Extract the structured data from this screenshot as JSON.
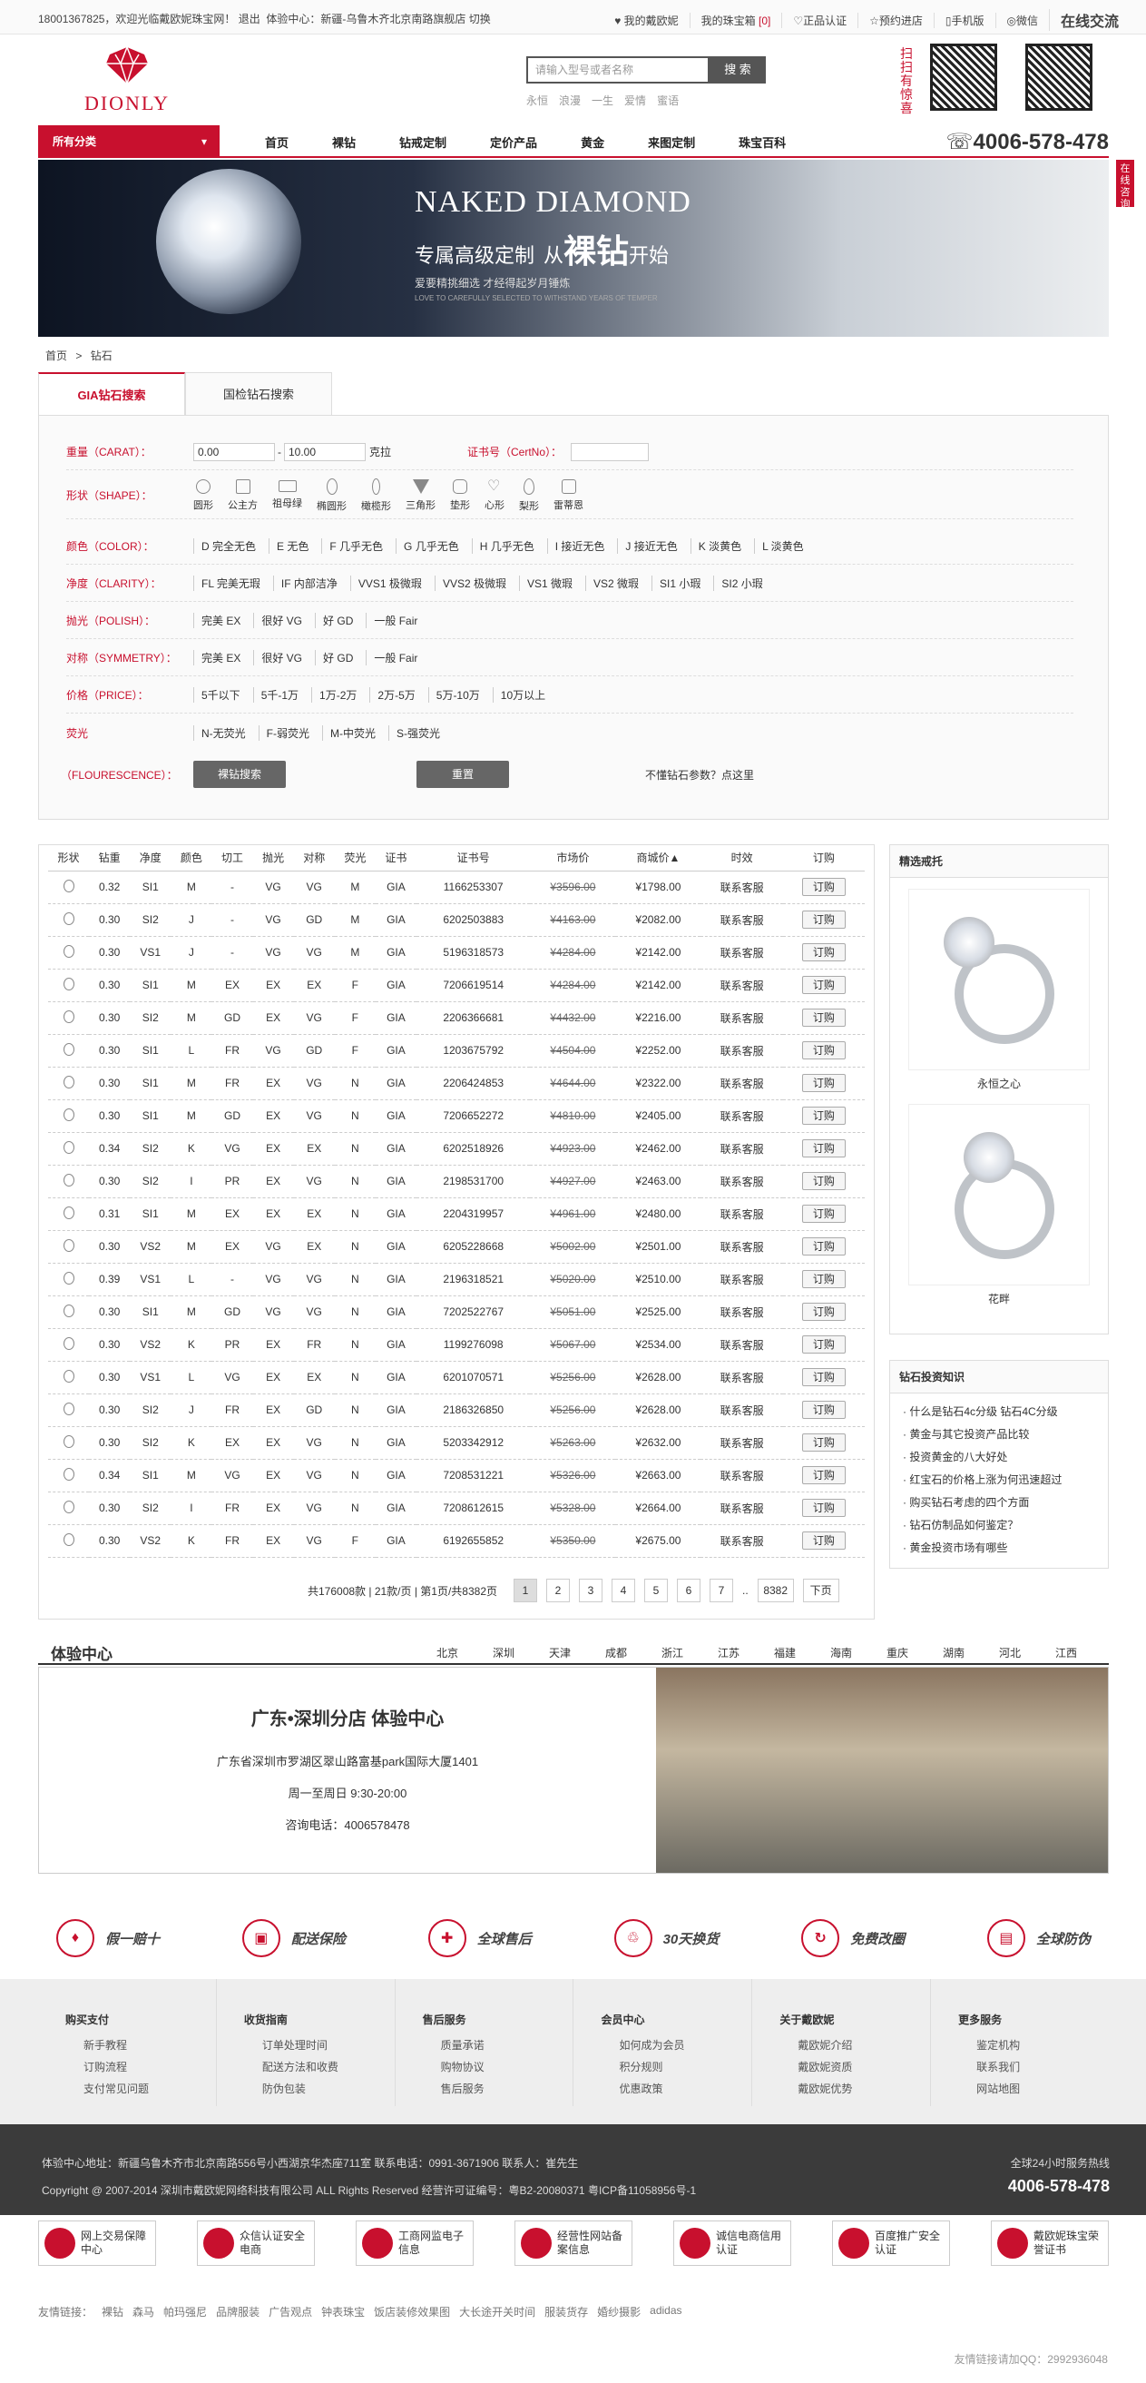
{
  "topbar": {
    "welcome": "18001367825，欢迎光临戴欧妮珠宝网！ 退出",
    "exp": "体验中心：新疆-乌鲁木齐北京南路旗舰店 切换",
    "my_dionly": "♥ 我的戴欧妮",
    "my_bank": "我的珠宝箱",
    "bank_count": "[0]",
    "authentic": "♡正品认证",
    "reserve": "☆预约进店",
    "mobile": "▯手机版",
    "wechat": "◎微信",
    "online": "在线交流"
  },
  "logo": {
    "text": "DIONLY"
  },
  "search": {
    "placeholder": "请输入型号或者名称",
    "button": "搜 索",
    "hot": [
      "永恒",
      "浪漫",
      "一生",
      "爱情",
      "蜜语"
    ]
  },
  "qr": {
    "label": "扫扫有惊喜"
  },
  "nav": {
    "category": "所有分类",
    "items": [
      "首页",
      "裸钻",
      "钻戒定制",
      "定价产品",
      "黄金",
      "来图定制",
      "珠宝百科"
    ],
    "tel": "4006-578-478"
  },
  "banner": {
    "title": "NAKED DIAMOND",
    "sub1": "专属高级定制",
    "sub2": "从",
    "sub3": "裸钻",
    "sub4": "开始",
    "line": "爱要精挑细选 才经得起岁月锤炼",
    "small": "LOVE TO CAREFULLY SELECTED TO WITHSTAND YEARS OF TEMPER"
  },
  "sidead": "在线咨询",
  "crumb": {
    "home": "首页",
    "sep": ">",
    "current": "钻石"
  },
  "tabs": {
    "gia": "GIA钻石搜索",
    "national": "国检钻石搜索"
  },
  "filter": {
    "weight_label": "重量（CARAT）：",
    "weight_min": "0.00",
    "weight_max": "10.00",
    "weight_unit": "克拉",
    "cert_label": "证书号（CertNo）：",
    "shape_label": "形状（SHAPE）：",
    "shapes": [
      "圆形",
      "公主方",
      "祖母绿",
      "椭圆形",
      "橄榄形",
      "三角形",
      "垫形",
      "心形",
      "梨形",
      "雷蒂恩"
    ],
    "color_label": "颜色（COLOR）：",
    "colors": [
      "D 完全无色",
      "E 无色",
      "F 几乎无色",
      "G 几乎无色",
      "H 几乎无色",
      "I 接近无色",
      "J 接近无色",
      "K 淡黄色",
      "L 淡黄色"
    ],
    "clarity_label": "净度（CLARITY）：",
    "clarities": [
      "FL 完美无瑕",
      "IF 内部洁净",
      "VVS1 极微瑕",
      "VVS2 极微瑕",
      "VS1 微瑕",
      "VS2 微瑕",
      "SI1 小瑕",
      "SI2 小瑕"
    ],
    "polish_label": "抛光（POLISH）：",
    "polish": [
      "完美 EX",
      "很好 VG",
      "好 GD",
      "一般 Fair"
    ],
    "symmetry_label": "对称（SYMMETRY）：",
    "symmetry": [
      "完美 EX",
      "很好 VG",
      "好 GD",
      "一般 Fair"
    ],
    "price_label": "价格（PRICE）：",
    "prices": [
      "5千以下",
      "5千-1万",
      "1万-2万",
      "2万-5万",
      "5万-10万",
      "10万以上"
    ],
    "fluor_label": "荧光",
    "fluor_label2": "（FLOURESCENCE）：",
    "fluors": [
      "N-无荧光",
      "F-弱荧光",
      "M-中荧光",
      "S-强荧光"
    ],
    "search_btn": "裸钻搜索",
    "reset_btn": "重置",
    "help": "不懂钻石参数？点这里"
  },
  "table": {
    "headers": [
      "形状",
      "钻重",
      "净度",
      "颜色",
      "切工",
      "抛光",
      "对称",
      "荧光",
      "证书",
      "证书号",
      "市场价",
      "商城价▲",
      "时效",
      "订购"
    ],
    "order": "订购",
    "rows": [
      [
        "0.32",
        "SI1",
        "M",
        "-",
        "VG",
        "VG",
        "M",
        "GIA",
        "1166253307",
        "¥3596.00",
        "¥1798.00",
        "联系客服"
      ],
      [
        "0.30",
        "SI2",
        "J",
        "-",
        "VG",
        "GD",
        "M",
        "GIA",
        "6202503883",
        "¥4163.00",
        "¥2082.00",
        "联系客服"
      ],
      [
        "0.30",
        "VS1",
        "J",
        "-",
        "VG",
        "VG",
        "M",
        "GIA",
        "5196318573",
        "¥4284.00",
        "¥2142.00",
        "联系客服"
      ],
      [
        "0.30",
        "SI1",
        "M",
        "EX",
        "EX",
        "EX",
        "F",
        "GIA",
        "7206619514",
        "¥4284.00",
        "¥2142.00",
        "联系客服"
      ],
      [
        "0.30",
        "SI2",
        "M",
        "GD",
        "EX",
        "VG",
        "F",
        "GIA",
        "2206366681",
        "¥4432.00",
        "¥2216.00",
        "联系客服"
      ],
      [
        "0.30",
        "SI1",
        "L",
        "FR",
        "VG",
        "GD",
        "F",
        "GIA",
        "1203675792",
        "¥4504.00",
        "¥2252.00",
        "联系客服"
      ],
      [
        "0.30",
        "SI1",
        "M",
        "FR",
        "EX",
        "VG",
        "N",
        "GIA",
        "2206424853",
        "¥4644.00",
        "¥2322.00",
        "联系客服"
      ],
      [
        "0.30",
        "SI1",
        "M",
        "GD",
        "EX",
        "VG",
        "N",
        "GIA",
        "7206652272",
        "¥4810.00",
        "¥2405.00",
        "联系客服"
      ],
      [
        "0.34",
        "SI2",
        "K",
        "VG",
        "EX",
        "EX",
        "N",
        "GIA",
        "6202518926",
        "¥4923.00",
        "¥2462.00",
        "联系客服"
      ],
      [
        "0.30",
        "SI2",
        "I",
        "PR",
        "EX",
        "VG",
        "N",
        "GIA",
        "2198531700",
        "¥4927.00",
        "¥2463.00",
        "联系客服"
      ],
      [
        "0.31",
        "SI1",
        "M",
        "EX",
        "EX",
        "EX",
        "N",
        "GIA",
        "2204319957",
        "¥4961.00",
        "¥2480.00",
        "联系客服"
      ],
      [
        "0.30",
        "VS2",
        "M",
        "EX",
        "VG",
        "EX",
        "N",
        "GIA",
        "6205228668",
        "¥5002.00",
        "¥2501.00",
        "联系客服"
      ],
      [
        "0.39",
        "VS1",
        "L",
        "-",
        "VG",
        "VG",
        "N",
        "GIA",
        "2196318521",
        "¥5020.00",
        "¥2510.00",
        "联系客服"
      ],
      [
        "0.30",
        "SI1",
        "M",
        "GD",
        "VG",
        "VG",
        "N",
        "GIA",
        "7202522767",
        "¥5051.00",
        "¥2525.00",
        "联系客服"
      ],
      [
        "0.30",
        "VS2",
        "K",
        "PR",
        "EX",
        "FR",
        "N",
        "GIA",
        "1199276098",
        "¥5067.00",
        "¥2534.00",
        "联系客服"
      ],
      [
        "0.30",
        "VS1",
        "L",
        "VG",
        "EX",
        "EX",
        "N",
        "GIA",
        "6201070571",
        "¥5256.00",
        "¥2628.00",
        "联系客服"
      ],
      [
        "0.30",
        "SI2",
        "J",
        "FR",
        "EX",
        "GD",
        "N",
        "GIA",
        "2186326850",
        "¥5256.00",
        "¥2628.00",
        "联系客服"
      ],
      [
        "0.30",
        "SI2",
        "K",
        "EX",
        "EX",
        "VG",
        "N",
        "GIA",
        "5203342912",
        "¥5263.00",
        "¥2632.00",
        "联系客服"
      ],
      [
        "0.34",
        "SI1",
        "M",
        "VG",
        "EX",
        "VG",
        "N",
        "GIA",
        "7208531221",
        "¥5326.00",
        "¥2663.00",
        "联系客服"
      ],
      [
        "0.30",
        "SI2",
        "I",
        "FR",
        "EX",
        "VG",
        "N",
        "GIA",
        "7208612615",
        "¥5328.00",
        "¥2664.00",
        "联系客服"
      ],
      [
        "0.30",
        "VS2",
        "K",
        "FR",
        "EX",
        "VG",
        "F",
        "GIA",
        "6192655852",
        "¥5350.00",
        "¥2675.00",
        "联系客服"
      ]
    ],
    "pager_info": "共176008款 | 21款/页 | 第1页/共8382页",
    "pages": [
      "1",
      "2",
      "3",
      "4",
      "5",
      "6",
      "7"
    ],
    "ellipsis": "..",
    "last": "8382",
    "next": "下页"
  },
  "rec": {
    "title": "精选戒托",
    "ring1": "永恒之心",
    "ring2": "花畔"
  },
  "know": {
    "title": "钻石投资知识",
    "items": [
      "· 什么是钻石4c分级 钻石4C分级",
      "· 黄金与其它投资产品比较",
      "· 投资黄金的八大好处",
      "· 红宝石的价格上涨为何迅速超过",
      "· 购买钻石考虑的四个方面",
      "· 钻石仿制品如何鉴定？",
      "· 黄金投资市场有哪些"
    ]
  },
  "exp": {
    "title": "体验中心",
    "cities": [
      "北京",
      "深圳",
      "天津",
      "成都",
      "浙江",
      "江苏",
      "福建",
      "海南",
      "重庆",
      "湖南",
      "河北",
      "江西"
    ],
    "store": "广东•深圳分店 体验中心",
    "addr": "广东省深圳市罗湖区翠山路富基park国际大厦1401",
    "hours": "周一至周日 9:30-20:00",
    "phone": "咨询电话：4006578478"
  },
  "feat": [
    {
      "icon": "♦",
      "label": "假一赔十"
    },
    {
      "icon": "▣",
      "label": "配送保险"
    },
    {
      "icon": "✚",
      "label": "全球售后"
    },
    {
      "icon": "♲",
      "label": "30天换货"
    },
    {
      "icon": "↻",
      "label": "免费改圈"
    },
    {
      "icon": "▤",
      "label": "全球防伪"
    }
  ],
  "footer": {
    "cols": [
      {
        "title": "购买支付",
        "items": [
          "新手教程",
          "订购流程",
          "支付常见问题"
        ]
      },
      {
        "title": "收货指南",
        "items": [
          "订单处理时间",
          "配送方法和收费",
          "防伪包装"
        ]
      },
      {
        "title": "售后服务",
        "items": [
          "质量承诺",
          "购物协议",
          "售后服务"
        ]
      },
      {
        "title": "会员中心",
        "items": [
          "如何成为会员",
          "积分规则",
          "优惠政策"
        ]
      },
      {
        "title": "关于戴欧妮",
        "items": [
          "戴欧妮介绍",
          "戴欧妮资质",
          "戴欧妮优势"
        ]
      },
      {
        "title": "更多服务",
        "items": [
          "鉴定机构",
          "联系我们",
          "网站地图"
        ]
      }
    ],
    "addr": "体验中心地址：新疆乌鲁木齐市北京南路556号小西湖京华杰座711室 联系电话：0991-3671906 联系人：崔先生",
    "copy": "Copyright @ 2007-2014 深圳市戴欧妮网络科技有限公司 ALL Rights Reserved 经营许可证编号：粤B2-20080371 粤ICP备11058956号-1",
    "hotline_label": "全球24小时服务热线",
    "hotline": "4006-578-478",
    "certs": [
      "网上交易保障中心",
      "众信认证安全电商",
      "工商网监电子信息",
      "经营性网站备案信息",
      "诚信电商信用认证",
      "百度推广安全认证",
      "戴欧妮珠宝荣誉证书"
    ],
    "friend": [
      "友情链接：",
      "裸钻",
      "森马",
      "帕玛强尼",
      "品牌服装",
      "广告观点",
      "钟表珠宝",
      "饭店装修效果图",
      "大长途开关时间",
      "服装货存",
      "婚纱摄影",
      "adidas"
    ],
    "qq": "友情链接请加QQ：2992936048"
  }
}
